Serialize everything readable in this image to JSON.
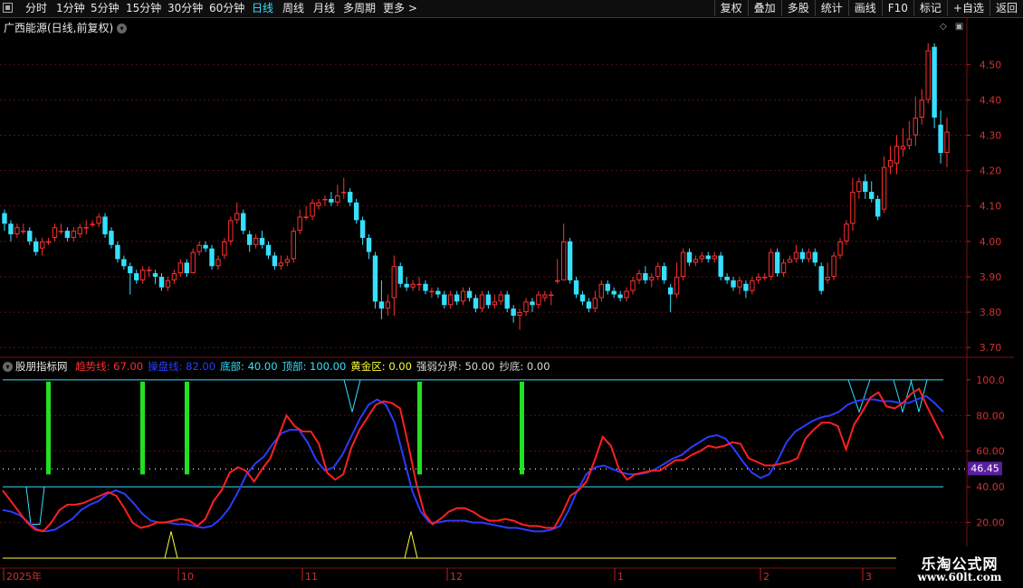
{
  "toolbar": {
    "items": [
      "分时",
      "1分钟",
      "5分钟",
      "15分钟",
      "30分钟",
      "60分钟",
      "日线",
      "周线",
      "月线",
      "多周期",
      "更多 >"
    ],
    "active_index": 6,
    "right_buttons": [
      "复权",
      "叠加",
      "多股",
      "统计",
      "画线",
      "F10",
      "标记",
      "+自选",
      "返回"
    ]
  },
  "stock": {
    "title": "广西能源(日线,前复权)"
  },
  "indicator": {
    "name": "股朋指标网",
    "items": [
      {
        "label": "趋势线: 67.00",
        "color": "#ff2d2d"
      },
      {
        "label": "操盘线: 82.00",
        "color": "#2a3cff"
      },
      {
        "label": "底部: 40.00",
        "color": "#35e0ff"
      },
      {
        "label": "顶部: 100.00",
        "color": "#35e0ff"
      },
      {
        "label": "黄金区: 0.00",
        "color": "#ffff3a"
      },
      {
        "label": "强弱分界: 50.00",
        "color": "#d8d8d8"
      },
      {
        "label": "抄底: 0.00",
        "color": "#d8d8d8"
      }
    ],
    "current_value": "46.45"
  },
  "price_axis": {
    "ticks": [
      "4.50",
      "4.40",
      "4.30",
      "4.20",
      "4.10",
      "4.00",
      "3.90",
      "3.80",
      "3.70"
    ]
  },
  "ind_axis": {
    "ticks": [
      "100.0",
      "80.00",
      "60.00",
      "40.00",
      "20.00"
    ]
  },
  "date_axis": {
    "labels": [
      "2025年",
      "10",
      "11",
      "12",
      "1",
      "2",
      "3"
    ]
  },
  "watermark": {
    "line1": "乐淘公式网",
    "line2": "www.60lt.com"
  },
  "colors": {
    "up": "#ff3030",
    "down": "#35e0ff",
    "trend": "#ff2020",
    "operate": "#2a3cff",
    "bottom": "#35e0ff",
    "green_bar": "#22e022",
    "gold": "#ffff3a"
  },
  "chart_data": {
    "type": "candlestick",
    "price_ylim": [
      3.68,
      4.58
    ],
    "candles": [
      [
        4.08,
        4.05,
        4.09,
        4.03
      ],
      [
        4.05,
        4.02,
        4.06,
        4.0
      ],
      [
        4.02,
        4.04,
        4.05,
        4.01
      ],
      [
        4.03,
        4.03,
        4.05,
        4.02
      ],
      [
        4.03,
        4.0,
        4.04,
        3.99
      ],
      [
        4.0,
        3.97,
        4.01,
        3.96
      ],
      [
        3.98,
        4.0,
        4.01,
        3.96
      ],
      [
        4.0,
        4.0,
        4.01,
        3.99
      ],
      [
        4.01,
        4.04,
        4.05,
        4.0
      ],
      [
        4.03,
        4.03,
        4.05,
        4.02
      ],
      [
        4.03,
        4.01,
        4.04,
        4.0
      ],
      [
        4.01,
        4.03,
        4.04,
        4.0
      ],
      [
        4.02,
        4.04,
        4.05,
        4.01
      ],
      [
        4.04,
        4.04,
        4.06,
        4.02
      ],
      [
        4.05,
        4.05,
        4.06,
        4.04
      ],
      [
        4.05,
        4.07,
        4.08,
        4.04
      ],
      [
        4.07,
        4.02,
        4.08,
        4.01
      ],
      [
        4.03,
        3.99,
        4.04,
        3.98
      ],
      [
        3.99,
        3.95,
        4.0,
        3.94
      ],
      [
        3.95,
        3.93,
        3.96,
        3.92
      ],
      [
        3.93,
        3.91,
        3.94,
        3.85
      ],
      [
        3.91,
        3.89,
        3.92,
        3.88
      ],
      [
        3.89,
        3.92,
        3.93,
        3.88
      ],
      [
        3.92,
        3.92,
        3.93,
        3.9
      ],
      [
        3.91,
        3.9,
        3.92,
        3.88
      ],
      [
        3.9,
        3.87,
        3.91,
        3.86
      ],
      [
        3.87,
        3.89,
        3.9,
        3.86
      ],
      [
        3.89,
        3.91,
        3.92,
        3.88
      ],
      [
        3.91,
        3.94,
        3.95,
        3.9
      ],
      [
        3.94,
        3.91,
        3.95,
        3.9
      ],
      [
        3.91,
        3.97,
        3.98,
        3.91
      ],
      [
        3.97,
        3.99,
        4.0,
        3.96
      ],
      [
        3.99,
        3.98,
        4.0,
        3.97
      ],
      [
        3.98,
        3.93,
        3.99,
        3.92
      ],
      [
        3.93,
        3.95,
        3.96,
        3.92
      ],
      [
        3.96,
        4.0,
        4.01,
        3.95
      ],
      [
        4.0,
        4.06,
        4.07,
        3.99
      ],
      [
        4.06,
        4.08,
        4.11,
        4.05
      ],
      [
        4.08,
        4.03,
        4.09,
        4.02
      ],
      [
        4.02,
        3.99,
        4.03,
        3.97
      ],
      [
        3.99,
        4.01,
        4.02,
        3.98
      ],
      [
        4.01,
        3.99,
        4.03,
        3.98
      ],
      [
        3.99,
        3.96,
        4.0,
        3.95
      ],
      [
        3.96,
        3.93,
        3.97,
        3.92
      ],
      [
        3.93,
        3.94,
        3.96,
        3.92
      ],
      [
        3.94,
        3.95,
        3.96,
        3.93
      ],
      [
        3.95,
        4.03,
        4.04,
        3.94
      ],
      [
        4.03,
        4.07,
        4.09,
        4.02
      ],
      [
        4.07,
        4.07,
        4.1,
        4.06
      ],
      [
        4.07,
        4.11,
        4.12,
        4.06
      ],
      [
        4.1,
        4.11,
        4.12,
        4.09
      ],
      [
        4.12,
        4.12,
        4.13,
        4.1
      ],
      [
        4.12,
        4.11,
        4.14,
        4.1
      ],
      [
        4.11,
        4.13,
        4.16,
        4.1
      ],
      [
        4.14,
        4.14,
        4.18,
        4.12
      ],
      [
        4.14,
        4.11,
        4.15,
        4.1
      ],
      [
        4.11,
        4.06,
        4.12,
        4.05
      ],
      [
        4.06,
        4.01,
        4.07,
        3.99
      ],
      [
        4.01,
        3.97,
        4.02,
        3.95
      ],
      [
        3.96,
        3.83,
        3.97,
        3.81
      ],
      [
        3.83,
        3.81,
        3.89,
        3.78
      ],
      [
        3.81,
        3.83,
        3.85,
        3.79
      ],
      [
        3.84,
        3.93,
        3.96,
        3.79
      ],
      [
        3.93,
        3.88,
        3.94,
        3.87
      ],
      [
        3.88,
        3.87,
        3.9,
        3.86
      ],
      [
        3.87,
        3.88,
        3.89,
        3.86
      ],
      [
        3.88,
        3.88,
        3.9,
        3.86
      ],
      [
        3.88,
        3.86,
        3.89,
        3.85
      ],
      [
        3.86,
        3.86,
        3.87,
        3.84
      ],
      [
        3.86,
        3.85,
        3.87,
        3.84
      ],
      [
        3.85,
        3.82,
        3.86,
        3.81
      ],
      [
        3.82,
        3.85,
        3.86,
        3.81
      ],
      [
        3.85,
        3.83,
        3.86,
        3.82
      ],
      [
        3.83,
        3.86,
        3.87,
        3.82
      ],
      [
        3.86,
        3.84,
        3.87,
        3.83
      ],
      [
        3.84,
        3.81,
        3.85,
        3.8
      ],
      [
        3.81,
        3.85,
        3.86,
        3.8
      ],
      [
        3.85,
        3.82,
        3.86,
        3.81
      ],
      [
        3.82,
        3.83,
        3.85,
        3.81
      ],
      [
        3.83,
        3.85,
        3.86,
        3.82
      ],
      [
        3.85,
        3.81,
        3.86,
        3.8
      ],
      [
        3.81,
        3.79,
        3.82,
        3.77
      ],
      [
        3.79,
        3.8,
        3.81,
        3.75
      ],
      [
        3.8,
        3.83,
        3.84,
        3.79
      ],
      [
        3.83,
        3.82,
        3.84,
        3.8
      ],
      [
        3.82,
        3.85,
        3.86,
        3.81
      ],
      [
        3.84,
        3.85,
        3.86,
        3.83
      ],
      [
        3.85,
        3.85,
        3.86,
        3.82
      ],
      [
        3.89,
        3.89,
        3.95,
        3.88
      ],
      [
        3.89,
        4.0,
        4.05,
        3.89
      ],
      [
        4.0,
        3.89,
        4.01,
        3.88
      ],
      [
        3.89,
        3.85,
        3.9,
        3.84
      ],
      [
        3.85,
        3.83,
        3.86,
        3.82
      ],
      [
        3.83,
        3.81,
        3.84,
        3.8
      ],
      [
        3.81,
        3.84,
        3.86,
        3.8
      ],
      [
        3.84,
        3.88,
        3.89,
        3.83
      ],
      [
        3.88,
        3.86,
        3.89,
        3.85
      ],
      [
        3.86,
        3.85,
        3.87,
        3.84
      ],
      [
        3.85,
        3.84,
        3.86,
        3.83
      ],
      [
        3.84,
        3.86,
        3.87,
        3.83
      ],
      [
        3.86,
        3.89,
        3.9,
        3.85
      ],
      [
        3.89,
        3.91,
        3.92,
        3.88
      ],
      [
        3.91,
        3.89,
        3.93,
        3.88
      ],
      [
        3.89,
        3.9,
        3.91,
        3.87
      ],
      [
        3.9,
        3.93,
        3.94,
        3.89
      ],
      [
        3.93,
        3.89,
        3.94,
        3.88
      ],
      [
        3.87,
        3.85,
        3.88,
        3.8
      ],
      [
        3.85,
        3.9,
        3.94,
        3.84
      ],
      [
        3.9,
        3.97,
        3.98,
        3.89
      ],
      [
        3.97,
        3.94,
        3.98,
        3.93
      ],
      [
        3.94,
        3.95,
        3.96,
        3.93
      ],
      [
        3.95,
        3.96,
        3.97,
        3.94
      ],
      [
        3.96,
        3.95,
        3.97,
        3.94
      ],
      [
        3.95,
        3.96,
        3.97,
        3.94
      ],
      [
        3.96,
        3.9,
        3.97,
        3.89
      ],
      [
        3.9,
        3.89,
        3.91,
        3.88
      ],
      [
        3.89,
        3.87,
        3.9,
        3.86
      ],
      [
        3.87,
        3.89,
        3.9,
        3.85
      ],
      [
        3.88,
        3.86,
        3.89,
        3.84
      ],
      [
        3.86,
        3.89,
        3.9,
        3.85
      ],
      [
        3.89,
        3.9,
        3.91,
        3.88
      ],
      [
        3.9,
        3.9,
        3.91,
        3.89
      ],
      [
        3.9,
        3.97,
        3.98,
        3.89
      ],
      [
        3.97,
        3.91,
        3.98,
        3.9
      ],
      [
        3.91,
        3.94,
        3.95,
        3.9
      ],
      [
        3.94,
        3.95,
        3.96,
        3.94
      ],
      [
        3.95,
        3.97,
        3.99,
        3.94
      ],
      [
        3.97,
        3.95,
        3.98,
        3.94
      ],
      [
        3.95,
        3.97,
        3.98,
        3.94
      ],
      [
        3.97,
        3.94,
        3.98,
        3.93
      ],
      [
        3.93,
        3.86,
        3.94,
        3.85
      ],
      [
        3.89,
        3.9,
        3.94,
        3.88
      ],
      [
        3.9,
        3.96,
        3.97,
        3.89
      ],
      [
        3.96,
        4.0,
        4.01,
        3.95
      ],
      [
        4.0,
        4.05,
        4.06,
        3.99
      ],
      [
        4.05,
        4.14,
        4.18,
        4.03
      ],
      [
        4.14,
        4.17,
        4.18,
        4.12
      ],
      [
        4.17,
        4.14,
        4.19,
        4.12
      ],
      [
        4.14,
        4.12,
        4.17,
        4.11
      ],
      [
        4.12,
        4.07,
        4.13,
        4.06
      ],
      [
        4.09,
        4.21,
        4.24,
        4.08
      ],
      [
        4.21,
        4.23,
        4.27,
        4.19
      ],
      [
        4.22,
        4.27,
        4.3,
        4.19
      ],
      [
        4.26,
        4.27,
        4.32,
        4.24
      ],
      [
        4.27,
        4.29,
        4.34,
        4.26
      ],
      [
        4.3,
        4.35,
        4.41,
        4.27
      ],
      [
        4.35,
        4.4,
        4.43,
        4.33
      ],
      [
        4.4,
        4.54,
        4.56,
        4.39
      ],
      [
        4.55,
        4.35,
        4.56,
        4.32
      ],
      [
        4.33,
        4.25,
        4.37,
        4.22
      ],
      [
        4.25,
        4.31,
        4.35,
        4.21
      ]
    ],
    "series": [
      {
        "name": "趋势线",
        "values": [
          38,
          32,
          26,
          20,
          16,
          15,
          20,
          27,
          30,
          30,
          31,
          33,
          35,
          37,
          35,
          28,
          20,
          17,
          18,
          20,
          20,
          21,
          22,
          21,
          18,
          22,
          32,
          38,
          48,
          51,
          49,
          43,
          50,
          56,
          68,
          80,
          74,
          71,
          71,
          64,
          48,
          44,
          47,
          62,
          72,
          79,
          86,
          88,
          87,
          84,
          64,
          42,
          25,
          19,
          22,
          26,
          28,
          28,
          26,
          23,
          21,
          21,
          22,
          21,
          19,
          18,
          18,
          17,
          17,
          25,
          35,
          38,
          43,
          55,
          68,
          63,
          50,
          44,
          47,
          48,
          49,
          49,
          52,
          55,
          55,
          58,
          60,
          63,
          62,
          63,
          65,
          64,
          56,
          54,
          52,
          52,
          53,
          54,
          56,
          67,
          72,
          76,
          76,
          74,
          61,
          75,
          82,
          90,
          93,
          85,
          84,
          87,
          92,
          95,
          85,
          76,
          67
        ]
      },
      {
        "name": "操盘线",
        "values": [
          27,
          26,
          24,
          20,
          16,
          15,
          16,
          19,
          22,
          27,
          30,
          32,
          36,
          38,
          36,
          31,
          25,
          21,
          20,
          20,
          19,
          19,
          18,
          17,
          18,
          22,
          28,
          37,
          47,
          53,
          57,
          64,
          70,
          72,
          72,
          65,
          55,
          49,
          51,
          58,
          68,
          78,
          86,
          89,
          86,
          76,
          57,
          38,
          26,
          20,
          20,
          21,
          21,
          21,
          20,
          20,
          19,
          18,
          17,
          17,
          16,
          15,
          15,
          16,
          18,
          27,
          38,
          47,
          51,
          52,
          50,
          48,
          47,
          47,
          48,
          50,
          53,
          56,
          58,
          62,
          65,
          68,
          69,
          67,
          61,
          54,
          48,
          45,
          47,
          55,
          65,
          71,
          74,
          77,
          79,
          80,
          82,
          86,
          88,
          89,
          89,
          88,
          88,
          87,
          87,
          89,
          91,
          87,
          82
        ]
      }
    ],
    "ind_ylim": [
      0,
      105
    ],
    "ref_lines": {
      "bottom": 40,
      "top": 100,
      "strong_weak": 50
    }
  }
}
